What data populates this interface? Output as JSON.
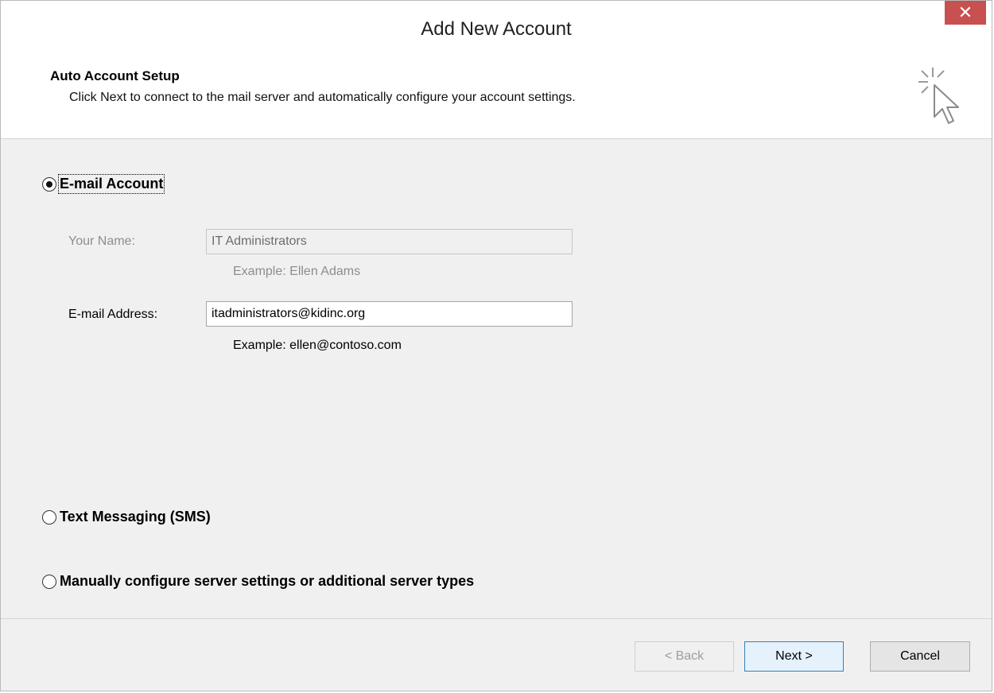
{
  "window": {
    "title": "Add New Account",
    "close_glyph": "✕"
  },
  "header": {
    "title": "Auto Account Setup",
    "description": "Click Next to connect to the mail server and automatically configure your account settings.",
    "icon": "cursor-click-icon"
  },
  "options": {
    "email_account": {
      "label": "E-mail Account",
      "checked": true
    },
    "sms": {
      "label": "Text Messaging (SMS)",
      "checked": false
    },
    "manual": {
      "label": "Manually configure server settings or additional server types",
      "checked": false
    }
  },
  "form": {
    "your_name": {
      "label": "Your Name:",
      "value": "IT Administrators",
      "example": "Example: Ellen Adams",
      "disabled": true
    },
    "email_address": {
      "label": "E-mail Address:",
      "value": "itadministrators@kidinc.org",
      "example": "Example: ellen@contoso.com",
      "disabled": false
    }
  },
  "buttons": {
    "back": "< Back",
    "next": "Next >",
    "cancel": "Cancel"
  },
  "colors": {
    "close_button": "#c75050",
    "default_button_border": "#3c7fb1"
  }
}
